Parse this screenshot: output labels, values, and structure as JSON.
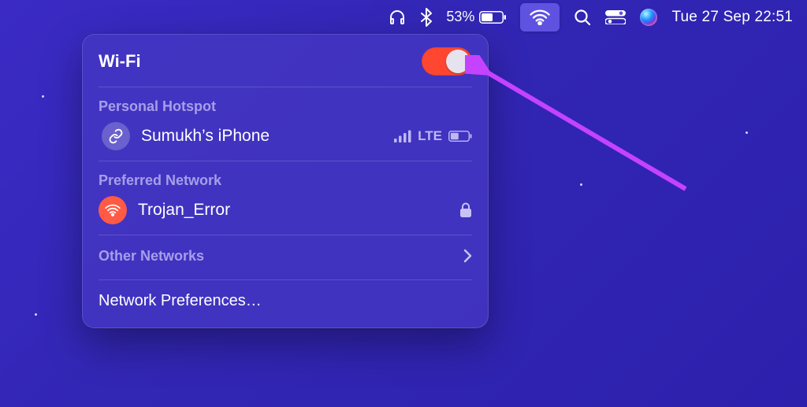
{
  "menubar": {
    "battery_percent": "53%",
    "clock": "Tue 27 Sep  22:51"
  },
  "wifi": {
    "title": "Wi-Fi",
    "toggle_on": true,
    "sections": {
      "hotspot": {
        "label": "Personal Hotspot",
        "device": "Sumukh’s iPhone",
        "signal_type": "LTE"
      },
      "preferred": {
        "label": "Preferred Network",
        "ssid": "Trojan_Error",
        "locked": true
      },
      "other_label": "Other Networks",
      "prefs_label": "Network Preferences…"
    }
  },
  "annotation": {
    "arrow_color": "#c542ff"
  }
}
